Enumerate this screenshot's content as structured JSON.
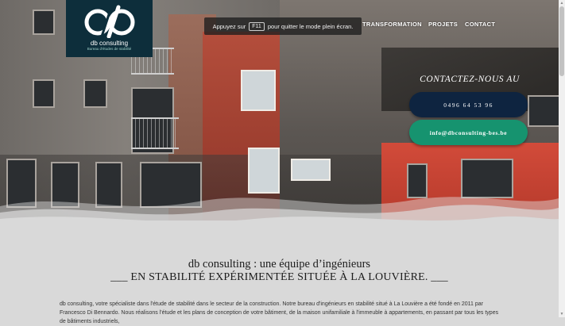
{
  "logo": {
    "name": "db consulting",
    "tagline": "Bureau d'études de stabilité"
  },
  "fullscreen_notice": {
    "prefix": "Appuyez sur",
    "key": "F11",
    "suffix": "pour quitter le mode plein écran."
  },
  "nav": {
    "items": [
      "TRANSFORMATION",
      "PROJETS",
      "CONTACT"
    ]
  },
  "hero": {
    "contact_title": "CONTACTEZ-NOUS AU",
    "phone": "0496 64 53 96",
    "email": "info@dbconsulting-bes.be"
  },
  "main": {
    "headline_line1": "db consulting : une équipe d’ingénieurs",
    "headline_line2": "___ EN STABILITÉ EXPÉRIMENTÉE SITUÉE À LA LOUVIÈRE. ___",
    "paragraph": "db consulting, votre spécialiste dans l'étude de stabilité dans le secteur de la construction. Notre bureau d'ingénieurs en stabilité situé à La Louvière a été fondé en 2011 par Francesco Di Bennardo. Nous réalisons l'étude et les plans de conception de votre bâtiment, de la maison unifamiliale à l'immeuble à appartements, en passant par tous les types de bâtiments industriels,"
  },
  "colors": {
    "logo_bg": "#0d2e3b",
    "phone_pill": "#0e2440",
    "email_pill": "#16936f",
    "page_bg": "#d9d9d9"
  }
}
